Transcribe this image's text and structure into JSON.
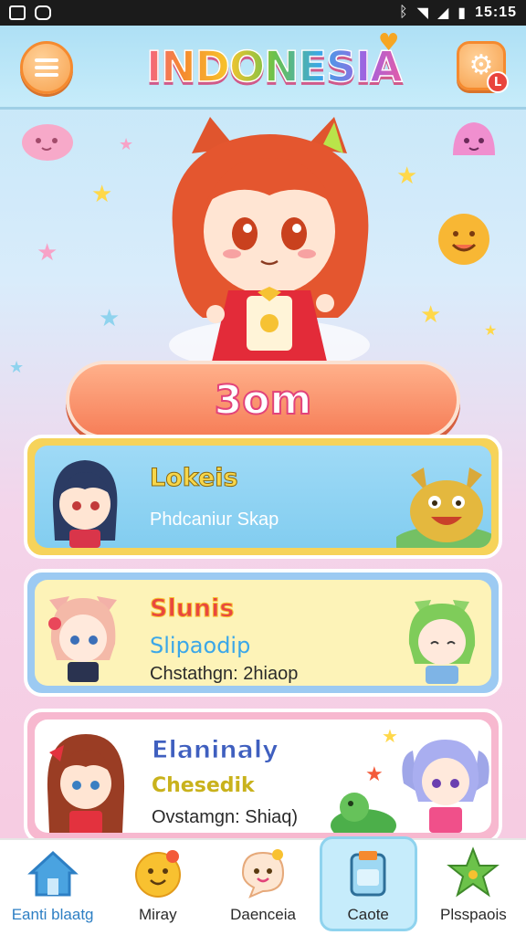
{
  "status_bar": {
    "time": "15:15"
  },
  "header": {
    "title": "INDONESIA",
    "settings_badge": "L"
  },
  "main_action": {
    "label": "3om"
  },
  "cards": [
    {
      "title": "Lokeis",
      "lines": [
        "Phdcaniur Skap"
      ]
    },
    {
      "title": "Slunis",
      "lines": [
        "Slipaodip",
        "Chstathgn: 2hiaop"
      ]
    },
    {
      "title": "Elaninaly",
      "lines": [
        "Chesedik",
        "Ovstamgn: Shiaq)"
      ]
    }
  ],
  "bottom_nav": [
    {
      "label": "Eanti blaatg",
      "icon": "home-icon"
    },
    {
      "label": "Miray",
      "icon": "smiley-icon"
    },
    {
      "label": "Daenceia",
      "icon": "chat-bubble-icon"
    },
    {
      "label": "Caote",
      "icon": "card-box-icon"
    },
    {
      "label": "Plsspaois",
      "icon": "star-creature-icon"
    }
  ],
  "colors": {
    "accent_orange": "#f67e58",
    "card1_border": "#f6d35a",
    "card2_border": "#9ccaf2",
    "card3_border": "#f7b8cf",
    "nav_active": "#c6ecfb"
  }
}
